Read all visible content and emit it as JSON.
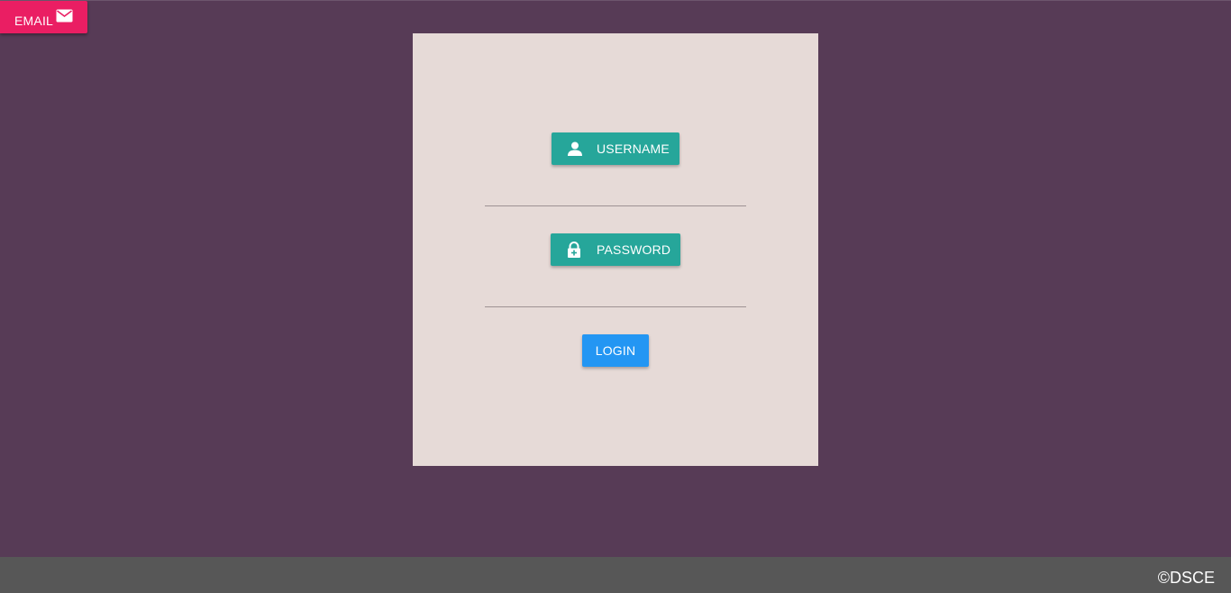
{
  "email_button": {
    "label": "EMAIL",
    "icon": "mail-icon",
    "color": "#ea1e63"
  },
  "login_card": {
    "background": "#e6dad7",
    "username_button": {
      "label": "USERNAME",
      "icon": "person-icon",
      "color": "#26a69a"
    },
    "username_input": {
      "value": ""
    },
    "password_button": {
      "label": "PASSWORD",
      "icon": "lock-icon",
      "color": "#26a69a"
    },
    "password_input": {
      "value": ""
    },
    "login_button": {
      "label": "LOGIN",
      "color": "#2396f3"
    }
  },
  "footer": {
    "copyright": "©DSCE",
    "background": "#575757"
  },
  "page_background": "#573b56"
}
